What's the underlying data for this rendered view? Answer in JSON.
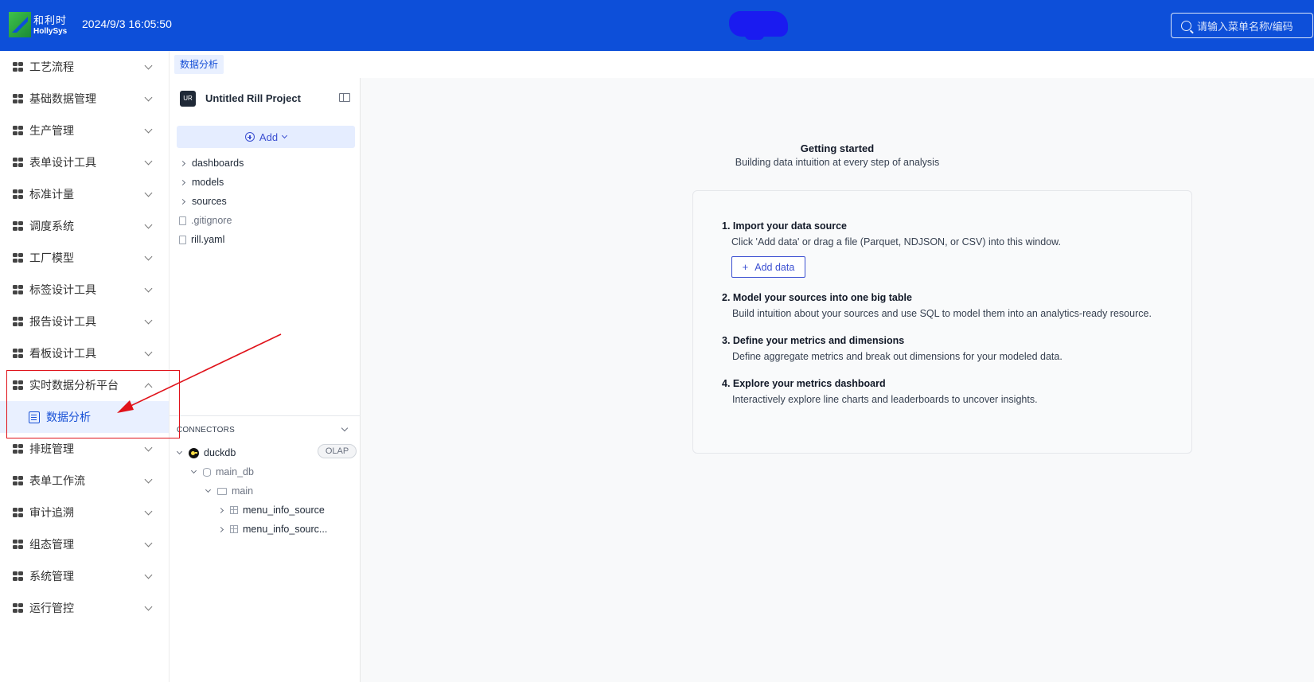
{
  "header": {
    "logo_cn": "和利时",
    "logo_en": "HollySys",
    "datetime": "2024/9/3 16:05:50",
    "search_placeholder": "请输入菜单名称/编码"
  },
  "sidebar": {
    "items": [
      {
        "label": "工艺流程"
      },
      {
        "label": "基础数据管理"
      },
      {
        "label": "生产管理"
      },
      {
        "label": "表单设计工具"
      },
      {
        "label": "标准计量"
      },
      {
        "label": "调度系统"
      },
      {
        "label": "工厂模型"
      },
      {
        "label": "标签设计工具"
      },
      {
        "label": "报告设计工具"
      },
      {
        "label": "看板设计工具"
      },
      {
        "label": "实时数据分析平台"
      },
      {
        "label": "排班管理"
      },
      {
        "label": "表单工作流"
      },
      {
        "label": "审计追溯"
      },
      {
        "label": "组态管理"
      },
      {
        "label": "系统管理"
      },
      {
        "label": "运行管控"
      }
    ],
    "active_sub_item": "数据分析"
  },
  "breadcrumb": {
    "tab": "数据分析"
  },
  "project": {
    "badge": "UR",
    "name": "Untitled Rill Project",
    "add_label": "Add",
    "files": [
      {
        "name": "dashboards",
        "type": "folder"
      },
      {
        "name": "models",
        "type": "folder"
      },
      {
        "name": "sources",
        "type": "folder"
      },
      {
        "name": ".gitignore",
        "type": "file"
      },
      {
        "name": "rill.yaml",
        "type": "file"
      }
    ]
  },
  "connectors": {
    "title": "CONNECTORS",
    "connector": "duckdb",
    "badge": "OLAP",
    "database": "main_db",
    "schema": "main",
    "tables": [
      "menu_info_source",
      "menu_info_sourc..."
    ]
  },
  "getting_started": {
    "title": "Getting started",
    "subtitle": "Building data intuition at every step of analysis",
    "steps": [
      {
        "title": "1. Import your data source",
        "desc": "Click 'Add data' or drag a file (Parquet, NDJSON, or CSV) into this window."
      },
      {
        "title": "2. Model your sources into one big table",
        "desc": "Build intuition about your sources and use SQL to model them into an analytics-ready resource."
      },
      {
        "title": "3. Define your metrics and dimensions",
        "desc": "Define aggregate metrics and break out dimensions for your modeled data."
      },
      {
        "title": "4. Explore your metrics dashboard",
        "desc": "Interactively explore line charts and leaderboards to uncover insights."
      }
    ],
    "add_data_label": "Add data"
  },
  "colors": {
    "header_bg": "#0d4fd9",
    "accent": "#1750d6",
    "annotation": "#e0121a"
  }
}
